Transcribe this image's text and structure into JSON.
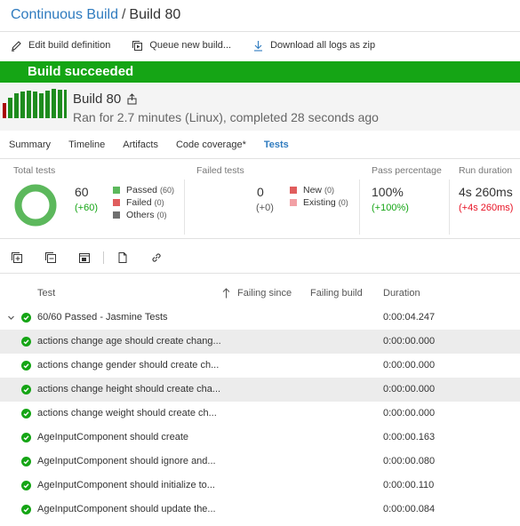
{
  "breadcrumb": {
    "parent": "Continuous Build",
    "separator": "/",
    "current": "Build 80"
  },
  "toolbar": {
    "edit_label": "Edit build definition",
    "queue_label": "Queue new build...",
    "download_label": "Download all logs as zip"
  },
  "banner": {
    "text": "Build succeeded",
    "color": "#15a515"
  },
  "build": {
    "title": "Build 80",
    "summary": "Ran for 2.7 minutes (Linux), completed 28 seconds ago"
  },
  "tabs": [
    "Summary",
    "Timeline",
    "Artifacts",
    "Code coverage*",
    "Tests"
  ],
  "active_tab": "Tests",
  "stats": {
    "total": {
      "header": "Total tests",
      "value": "60",
      "delta": "(+60)",
      "legend": [
        {
          "label": "Passed",
          "count": "(60)",
          "color": "#5cb85c"
        },
        {
          "label": "Failed",
          "count": "(0)",
          "color": "#e05d5d"
        },
        {
          "label": "Others",
          "count": "(0)",
          "color": "#707070"
        }
      ]
    },
    "failed": {
      "header": "Failed tests",
      "value": "0",
      "delta": "(+0)",
      "legend": [
        {
          "label": "New",
          "count": "(0)",
          "color": "#e05d5d"
        },
        {
          "label": "Existing",
          "count": "(0)",
          "color": "#f2a0a5"
        }
      ]
    },
    "pass_percentage": {
      "header": "Pass percentage",
      "value": "100%",
      "delta": "(+100%)"
    },
    "run_duration": {
      "header": "Run duration",
      "value": "4s 260ms",
      "delta": "(+4s 260ms)"
    }
  },
  "columns": {
    "test": "Test",
    "failing_since": "Failing since",
    "failing_build": "Failing build",
    "duration": "Duration"
  },
  "group": {
    "label": "60/60 Passed - Jasmine Tests",
    "duration": "0:00:04.247"
  },
  "tests": [
    {
      "name": "actions change age should create chang...",
      "duration": "0:00:00.000"
    },
    {
      "name": "actions change gender should create ch...",
      "duration": "0:00:00.000"
    },
    {
      "name": "actions change height should create cha...",
      "duration": "0:00:00.000"
    },
    {
      "name": "actions change weight should create ch...",
      "duration": "0:00:00.000"
    },
    {
      "name": "AgeInputComponent should create",
      "duration": "0:00:00.163"
    },
    {
      "name": "AgeInputComponent should ignore and...",
      "duration": "0:00:00.080"
    },
    {
      "name": "AgeInputComponent should initialize to...",
      "duration": "0:00:00.110"
    },
    {
      "name": "AgeInputComponent should update the...",
      "duration": "0:00:00.084"
    }
  ],
  "colors": {
    "accent": "#2f7bbf",
    "success": "#15a515",
    "error": "#e81123"
  }
}
